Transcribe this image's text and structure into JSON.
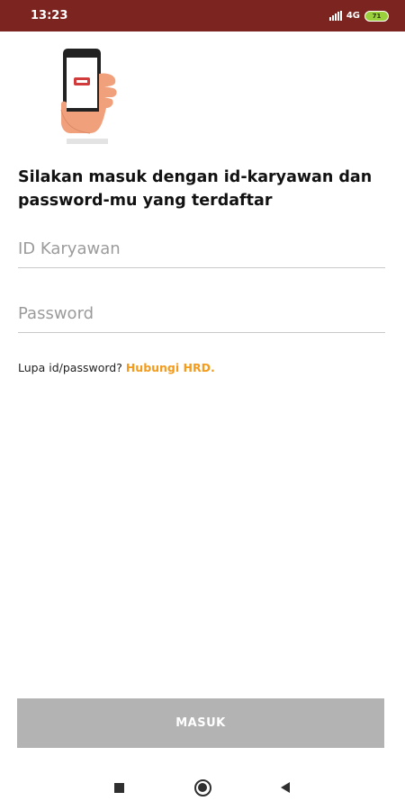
{
  "status_bar": {
    "time": "13:23",
    "network": "4G",
    "battery": "71"
  },
  "login": {
    "heading": "Silakan masuk dengan id-karyawan dan password-mu yang terdaftar",
    "id_placeholder": "ID Karyawan",
    "password_placeholder": "Password",
    "forgot_text": "Lupa id/password?",
    "forgot_link": "Hubungi HRD.",
    "submit_label": "MASUK"
  },
  "colors": {
    "status_bar": "#7b2420",
    "link": "#f59b1c",
    "button": "#b3b3b3"
  },
  "icons": {
    "hero": "hand-holding-phone-icon",
    "recent": "square-icon",
    "home": "circle-icon",
    "back": "triangle-back-icon"
  }
}
